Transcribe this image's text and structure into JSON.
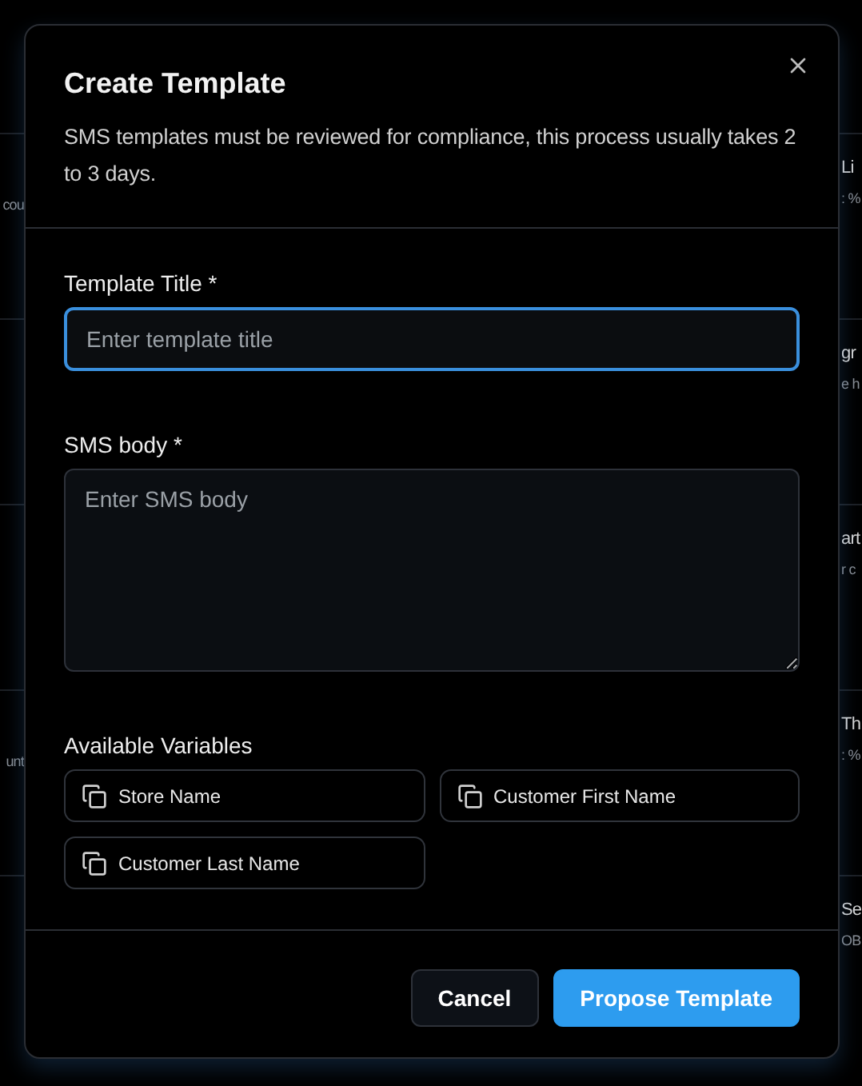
{
  "background": {
    "rows": [
      {
        "left_subtitle": "cou",
        "right_title": "Li",
        "right_subtitle": ": %"
      },
      {
        "right_title": "gr",
        "right_subtitle": "e h"
      },
      {
        "right_title": "art",
        "right_subtitle": "r c"
      },
      {
        "left_subtitle": "unt",
        "right_title": "Th",
        "right_subtitle": ": %"
      },
      {
        "right_title": "Se",
        "right_subtitle": "OB"
      }
    ]
  },
  "dialog": {
    "title": "Create Template",
    "description": "SMS templates must be reviewed for compliance, this process usually takes 2 to 3 days.",
    "fields": [
      {
        "kind": "input",
        "label": "Template Title *",
        "placeholder": "Enter template title",
        "focused": true
      },
      {
        "kind": "textarea",
        "label": "SMS body *",
        "placeholder": "Enter SMS body",
        "focused": false
      }
    ],
    "variables_label": "Available Variables",
    "variables": [
      "Store Name",
      "Customer First Name",
      "Customer Last Name"
    ],
    "buttons": [
      {
        "kind": "secondary",
        "label": "Cancel"
      },
      {
        "kind": "primary",
        "label": "Propose Template"
      }
    ]
  }
}
